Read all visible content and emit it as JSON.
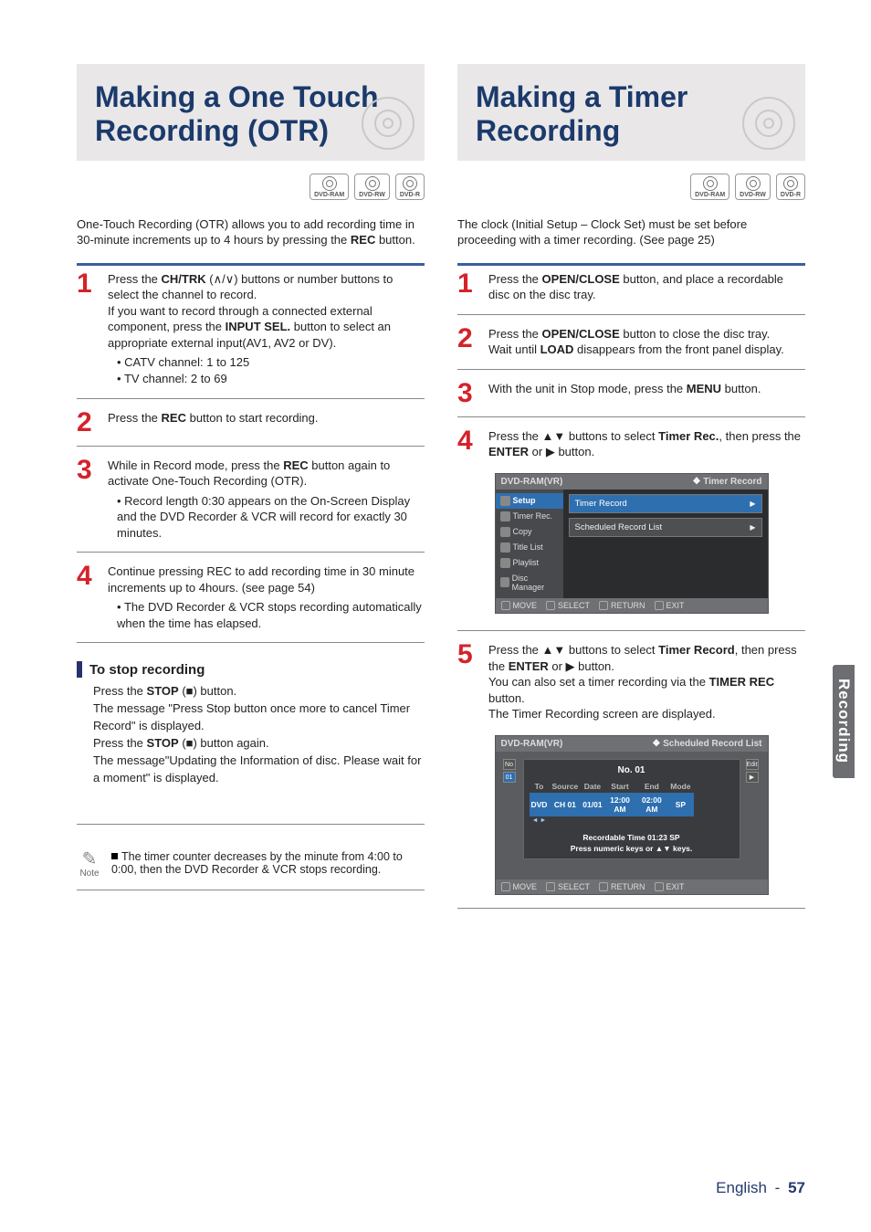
{
  "side_tab": "Recording",
  "footer": {
    "lang": "English",
    "dash": "-",
    "page": "57"
  },
  "disc_labels": {
    "ram": "DVD-RAM",
    "rw": "DVD-RW",
    "r": "DVD-R"
  },
  "left": {
    "title_l1": "Making a One Touch",
    "title_l2": "Recording (OTR)",
    "intro_a": "One-Touch Recording (OTR) allows you to add recording time in 30-minute increments up to 4 hours by pressing the ",
    "intro_b": "REC",
    "intro_c": " button.",
    "s1": {
      "pre": "Press the ",
      "btn": "CH/TRK",
      "post": " (∧/∨) buttons or number buttons to select the channel to record.",
      "l2a": "If you want to record through a connected external component, press the ",
      "l2b": "INPUT SEL.",
      "l2c": " button to select an appropriate external input(AV1, AV2 or DV).",
      "b1": "CATV channel: 1 to 125",
      "b2": "TV channel: 2 to 69"
    },
    "s2": {
      "pre": "Press the ",
      "btn": "REC",
      "post": " button to start recording."
    },
    "s3": {
      "pre": "While in Record mode, press the ",
      "btn": "REC",
      "post": " button again to activate One-Touch Recording (OTR).",
      "b1": "Record length 0:30 appears on the On-Screen Display and the DVD Recorder & VCR will record for exactly 30 minutes."
    },
    "s4": {
      "l1": "Continue pressing REC to add recording time in 30 minute increments up to 4hours. (see page 54)",
      "b1": "The DVD Recorder & VCR stops recording automatically when the time has elapsed."
    },
    "sub": "To stop recording",
    "stop": {
      "l1a": "Press the ",
      "l1b": "STOP",
      "l1c": " (■) button.",
      "l2": "The message \"Press Stop button once more to cancel Timer Record\" is displayed.",
      "l3a": "Press the ",
      "l3b": "STOP",
      "l3c": " (■) button again.",
      "l4": "The message\"Updating the Information of disc. Please wait for a moment\" is displayed."
    },
    "note_label": "Note",
    "note": "The timer counter decreases by the minute from 4:00 to 0:00, then the DVD Recorder & VCR stops recording."
  },
  "right": {
    "title_l1": "Making a Timer",
    "title_l2": "Recording",
    "intro": "The clock (Initial Setup – Clock Set) must be set before proceeding with a timer recording. (See page 25)",
    "s1": {
      "pre": "Press the ",
      "btn": "OPEN/CLOSE",
      "post": " button, and place a recordable disc on the disc tray."
    },
    "s2": {
      "pre": "Press the ",
      "btn": "OPEN/CLOSE",
      "post": " button to close the disc tray.",
      "l2a": "Wait until ",
      "l2b": "LOAD",
      "l2c": " disappears from the front panel display."
    },
    "s3": {
      "pre": "With the unit in Stop mode, press the ",
      "btn": "MENU",
      "post": " button."
    },
    "s4": {
      "pre": "Press the ▲▼ buttons to select ",
      "btn": "Timer Rec.",
      "post": ", then press the ",
      "btn2": "ENTER",
      "post2": " or ▶ button."
    },
    "s5": {
      "pre": "Press the ▲▼ buttons to select ",
      "btn": "Timer Record",
      "post": ", then press the ",
      "btn2": "ENTER",
      "post2": " or ▶ button.",
      "l2a": "You can also set a timer recording via the ",
      "l2b": "TIMER REC",
      "l2c": " button.",
      "l3": "The Timer Recording screen are displayed."
    }
  },
  "osd1": {
    "mode": "DVD-RAM(VR)",
    "crumb": "Timer Record",
    "side": [
      "Setup",
      "Timer Rec.",
      "Copy",
      "Title List",
      "Playlist",
      "Disc Manager"
    ],
    "rows": [
      "Timer Record",
      "Scheduled Record List"
    ],
    "foot": [
      "MOVE",
      "SELECT",
      "RETURN",
      "EXIT"
    ]
  },
  "osd2": {
    "mode": "DVD-RAM(VR)",
    "crumb": "Scheduled Record List",
    "no_label": "No",
    "no_val": "01",
    "edit": "Edit",
    "panel_title": "No. 01",
    "headers": [
      "To",
      "Source",
      "Date",
      "Start",
      "End",
      "Mode"
    ],
    "values": [
      "DVD",
      "CH 01",
      "01/01",
      "12:00 AM",
      "02:00 AM",
      "SP"
    ],
    "arrow_hint": "◄ ►",
    "msg1": "Recordable Time 01:23 SP",
    "msg2": "Press numeric keys or ▲▼ keys.",
    "foot": [
      "MOVE",
      "SELECT",
      "RETURN",
      "EXIT"
    ]
  }
}
